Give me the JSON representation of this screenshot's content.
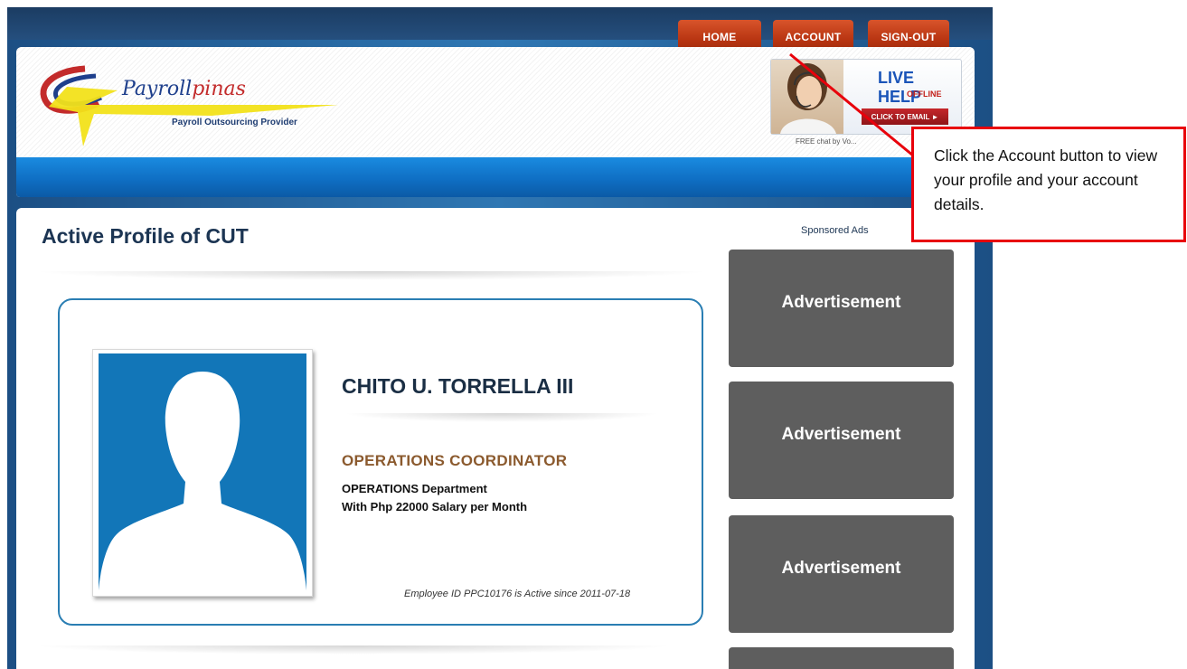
{
  "nav": {
    "home": "HOME",
    "account": "ACCOUNT",
    "signout": "SIGN-OUT"
  },
  "logo": {
    "brand_main": "Payroll",
    "brand_accent": "pinas",
    "tagline": "Payroll Outsourcing Provider"
  },
  "live_help": {
    "title": "LIVE HELP",
    "status": "OFFLINE",
    "email_button": "CLICK TO EMAIL ►",
    "credit": "FREE chat by Vo..."
  },
  "page": {
    "title": "Active Profile of CUT"
  },
  "profile": {
    "name": "CHITO U. TORRELLA III",
    "position": "OPERATIONS COORDINATOR",
    "department": "OPERATIONS Department",
    "salary": "With Php 22000 Salary per Month",
    "status_line": "Employee ID PPC10176 is Active since 2011-07-18"
  },
  "ads": {
    "label": "Sponsored Ads",
    "items": [
      "Advertisement",
      "Advertisement",
      "Advertisement",
      ""
    ]
  },
  "callout": {
    "text": "Click the Account button to view your profile and your account details."
  },
  "colors": {
    "nav_button": "#b73411",
    "header_bar": "#1a8be0",
    "card_border": "#2a7eb3",
    "ad_box": "#5e5e5e",
    "callout_border": "#e8000b"
  }
}
